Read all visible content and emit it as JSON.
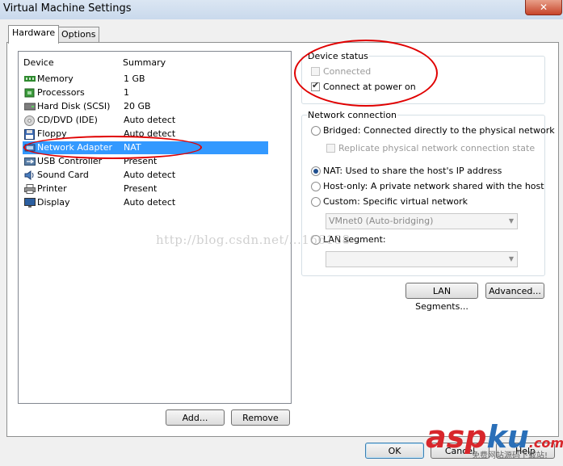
{
  "window": {
    "title": "Virtual Machine Settings",
    "close_glyph": "✕"
  },
  "tabs": [
    {
      "label": "Hardware"
    },
    {
      "label": "Options"
    }
  ],
  "device_list": {
    "columns": [
      "Device",
      "Summary"
    ],
    "rows": [
      {
        "device": "Memory",
        "summary": "1 GB",
        "icon": "memory-icon"
      },
      {
        "device": "Processors",
        "summary": "1",
        "icon": "processor-icon"
      },
      {
        "device": "Hard Disk (SCSI)",
        "summary": "20 GB",
        "icon": "hard-disk-icon"
      },
      {
        "device": "CD/DVD (IDE)",
        "summary": "Auto detect",
        "icon": "cd-dvd-icon"
      },
      {
        "device": "Floppy",
        "summary": "Auto detect",
        "icon": "floppy-icon"
      },
      {
        "device": "Network Adapter",
        "summary": "NAT",
        "icon": "network-adapter-icon",
        "selected": true
      },
      {
        "device": "USB Controller",
        "summary": "Present",
        "icon": "usb-icon"
      },
      {
        "device": "Sound Card",
        "summary": "Auto detect",
        "icon": "sound-card-icon"
      },
      {
        "device": "Printer",
        "summary": "Present",
        "icon": "printer-icon"
      },
      {
        "device": "Display",
        "summary": "Auto detect",
        "icon": "display-icon"
      }
    ],
    "selected_color": "#3399ff"
  },
  "buttons": {
    "add": "Add...",
    "remove": "Remove",
    "lan_segments": "LAN Segments...",
    "advanced": "Advanced...",
    "ok": "OK",
    "cancel": "Cancel",
    "help": "Help"
  },
  "device_status": {
    "title": "Device status",
    "connected": {
      "label": "Connected",
      "checked": false,
      "enabled": false
    },
    "connect_at_power_on": {
      "label": "Connect at power on",
      "checked": true
    }
  },
  "network_connection": {
    "title": "Network connection",
    "options": [
      {
        "label": "Bridged: Connected directly to the physical network",
        "selected": false
      },
      {
        "label": "NAT: Used to share the host's IP address",
        "selected": true
      },
      {
        "label": "Host-only: A private network shared with the host",
        "selected": false
      },
      {
        "label": "Custom: Specific virtual network",
        "selected": false
      },
      {
        "label": "LAN segment:",
        "selected": false
      }
    ],
    "replicate": {
      "label": "Replicate physical network connection state",
      "checked": false,
      "enabled": false
    },
    "custom_network_value": "VMnet0 (Auto-bridging)",
    "lan_segment_value": ""
  },
  "overlay": {
    "watermark": "http://blog.csdn.net/...166188",
    "brand_a": "asp",
    "brand_b": "ku",
    "brand_suffix": ".com",
    "brand_tagline": "免费网站源码下载站!",
    "annotation_color": "#e00000"
  }
}
